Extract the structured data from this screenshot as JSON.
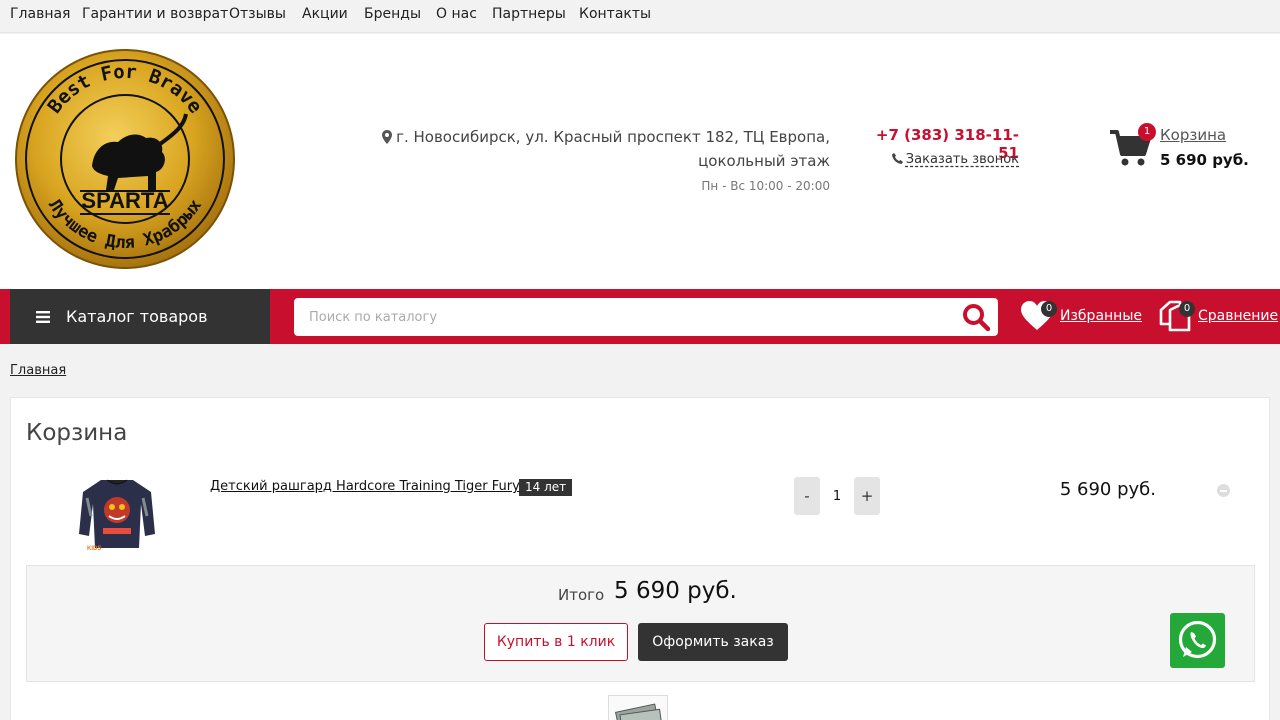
{
  "top_nav": [
    "Главная",
    "Гарантии и возврат",
    "Отзывы",
    "Акции",
    "Бренды",
    "О нас",
    "Партнеры",
    "Контакты"
  ],
  "logo": {
    "ring_top": "Best For Brave",
    "ring_bottom": "Лучшее Для Храбрых",
    "center": "SPARTA",
    "colors": {
      "gold": "#d9a520",
      "black": "#111111"
    }
  },
  "header": {
    "address": "г. Новосибирск, ул. Красный проспект 182, ТЦ Европа, цокольный этаж",
    "hours": "Пн - Вс 10:00 - 20:00",
    "phone": "+7 (383) 318-11-51",
    "callback": "Заказать звонок",
    "cart": {
      "label": "Корзина",
      "count": "1",
      "sum": "5 690 руб."
    }
  },
  "nav_bar": {
    "catalog_label": "Каталог товаров",
    "search_placeholder": "Поиск по каталогу",
    "favorites": {
      "label": "Избранные",
      "count": "0"
    },
    "compare": {
      "label": "Сравнение",
      "count": "0"
    }
  },
  "breadcrumb": "Главная",
  "cart_page": {
    "title": "Корзина",
    "items": [
      {
        "name": "Детский рашгард Hardcore Training Tiger Fury",
        "tag": "14 лет",
        "qty": "1",
        "price": "5 690 руб."
      }
    ],
    "total_label": "Итого",
    "total_value": "5 690 руб.",
    "buy_one_click": "Купить в 1 клик",
    "checkout": "Оформить заказ"
  },
  "colors": {
    "accent": "#c8102e",
    "dark": "#333333",
    "whatsapp": "#25a83a"
  }
}
